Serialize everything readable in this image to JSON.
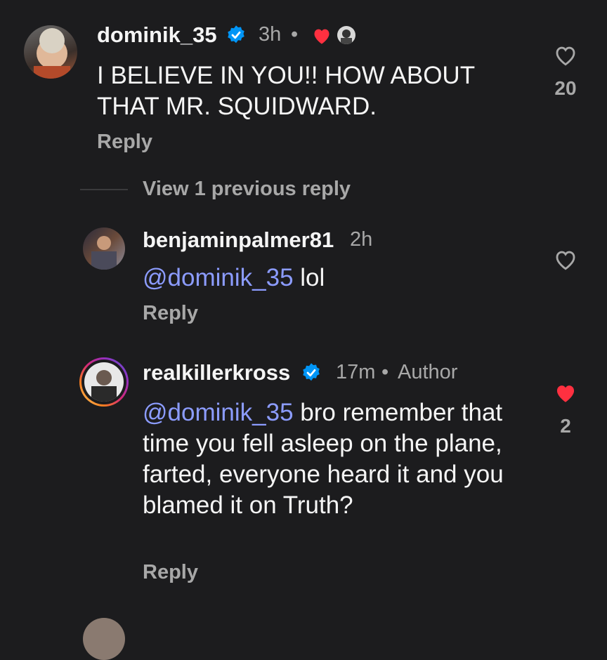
{
  "comments": [
    {
      "username": "dominik_35",
      "verified": true,
      "time": "3h",
      "text": "I BELIEVE IN YOU!! HOW ABOUT THAT MR. SQUIDWARD.",
      "reply_label": "Reply",
      "likes": "20",
      "liked": false,
      "author_liked": true
    },
    {
      "view_previous": "View 1 previous reply"
    },
    {
      "username": "benjaminpalmer81",
      "verified": false,
      "time": "2h",
      "mention": "@dominik_35",
      "text": "lol",
      "reply_label": "Reply",
      "likes": "",
      "liked": false
    },
    {
      "username": "realkillerkross",
      "verified": true,
      "time": "17m",
      "author_label": "Author",
      "mention": "@dominik_35",
      "text": "bro remember that time you fell asleep on the plane, farted, everyone heard it and you blamed it on Truth?",
      "reply_label": "Reply",
      "likes": "2",
      "liked": true
    }
  ],
  "colors": {
    "background": "#1c1c1e",
    "verified": "#0095f6",
    "heart_red": "#ff3040",
    "mention": "#8c9cff",
    "muted": "#a8a8a8"
  }
}
